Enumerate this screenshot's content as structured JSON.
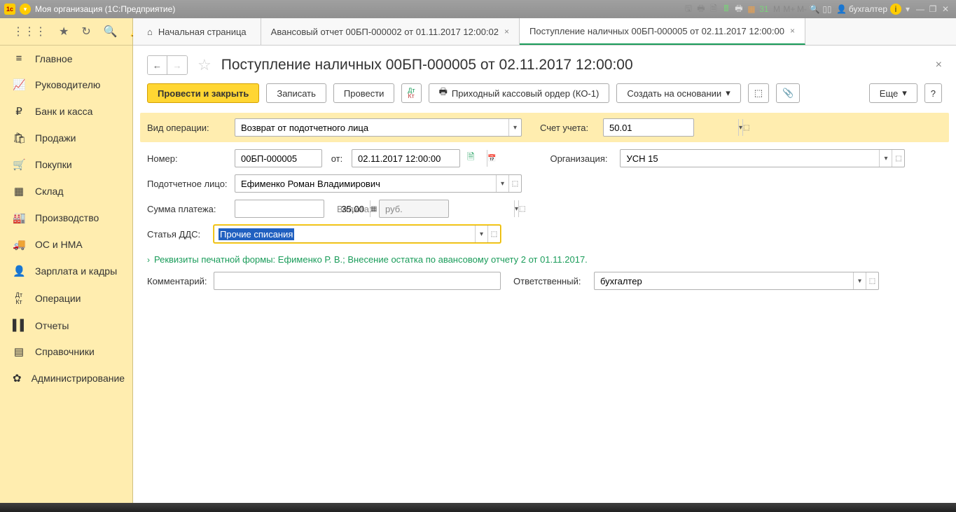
{
  "titlebar": {
    "title": "Моя организация  (1С:Предприятие)",
    "user": "бухгалтер",
    "m_labels": [
      "М",
      "М+",
      "М-"
    ]
  },
  "sidebar": {
    "items": [
      {
        "label": "Главное",
        "icon": "≡"
      },
      {
        "label": "Руководителю",
        "icon": "📈"
      },
      {
        "label": "Банк и касса",
        "icon": "₽"
      },
      {
        "label": "Продажи",
        "icon": "🛍"
      },
      {
        "label": "Покупки",
        "icon": "🛒"
      },
      {
        "label": "Склад",
        "icon": "▦"
      },
      {
        "label": "Производство",
        "icon": "🏭"
      },
      {
        "label": "ОС и НМА",
        "icon": "🚚"
      },
      {
        "label": "Зарплата и кадры",
        "icon": "👤"
      },
      {
        "label": "Операции",
        "icon": "Дт/Кт"
      },
      {
        "label": "Отчеты",
        "icon": "▌▌"
      },
      {
        "label": "Справочники",
        "icon": "▤"
      },
      {
        "label": "Администрирование",
        "icon": "✿"
      }
    ]
  },
  "tabs": {
    "home": "Начальная страница",
    "t1": "Авансовый отчет 00БП-000002 от 01.11.2017 12:00:02",
    "t2": "Поступление наличных 00БП-000005 от 02.11.2017 12:00:00"
  },
  "page": {
    "title": "Поступление наличных 00БП-000005 от 02.11.2017 12:00:00"
  },
  "toolbar": {
    "post_close": "Провести и закрыть",
    "save": "Записать",
    "post": "Провести",
    "dtkt": "Дт/Кт",
    "print": "Приходный кассовый ордер (КО-1)",
    "create_based": "Создать на основании",
    "more": "Еще",
    "help": "?"
  },
  "form": {
    "operation_lbl": "Вид операции:",
    "operation_val": "Возврат от подотчетного лица",
    "account_lbl": "Счет учета:",
    "account_val": "50.01",
    "number_lbl": "Номер:",
    "number_val": "00БП-000005",
    "date_lbl": "от:",
    "date_val": "02.11.2017 12:00:00",
    "org_lbl": "Организация:",
    "org_val": "УСН 15",
    "person_lbl": "Подотчетное лицо:",
    "person_val": "Ефименко Роман Владимирович",
    "sum_lbl": "Сумма платежа:",
    "sum_val": "35,00",
    "currency_lbl": "Валюта:",
    "currency_val": "руб.",
    "dds_lbl": "Статья ДДС:",
    "dds_val": "Прочие списания",
    "print_details": "Реквизиты печатной формы: Ефименко Р. В.; Внесение остатка по авансовому отчету 2 от 01.11.2017.",
    "comment_lbl": "Комментарий:",
    "responsible_lbl": "Ответственный:",
    "responsible_val": "бухгалтер"
  }
}
